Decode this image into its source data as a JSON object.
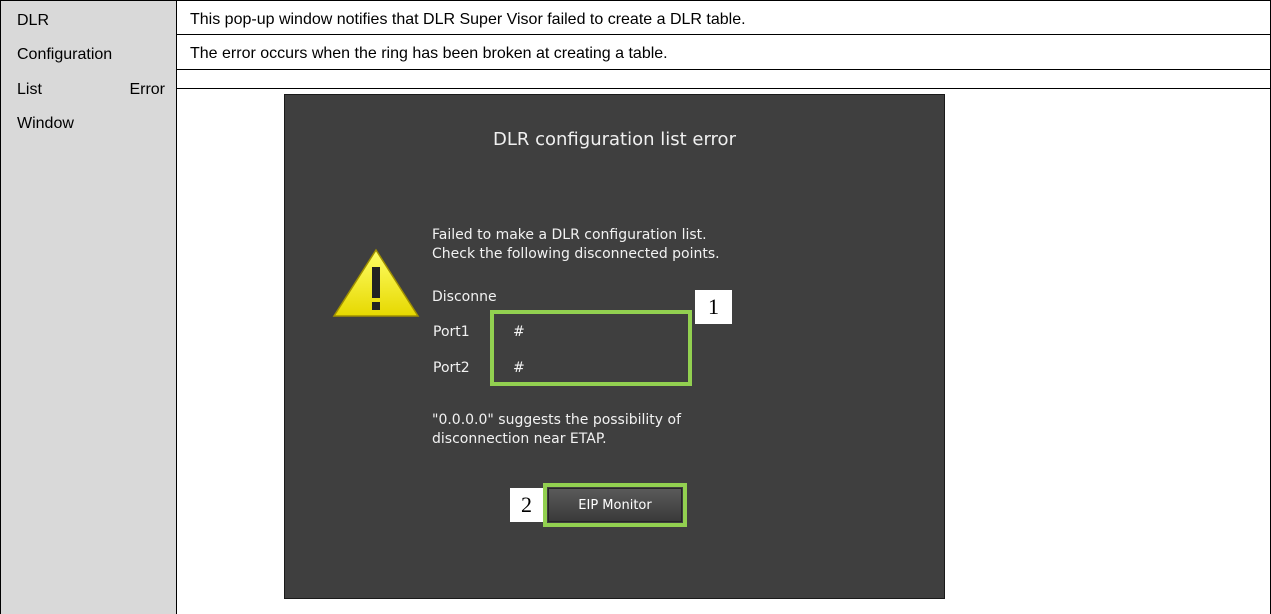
{
  "left_label": {
    "line1": "DLR",
    "line2": "Configuration",
    "line3a": "List",
    "line3b": "Error",
    "line4": "Window"
  },
  "description": {
    "line1": "This pop-up window notifies that DLR Super Visor failed to create a DLR table.",
    "line2": "The error occurs when the ring has been broken at creating a table."
  },
  "dialog": {
    "title": "DLR configuration list error",
    "message_line1": "Failed to make a DLR configuration list.",
    "message_line2": "Check the following disconnected points.",
    "disconnected_label": "Disconne",
    "port1_label": "Port1",
    "port1_value": "#",
    "port2_label": "Port2",
    "port2_value": "#",
    "note_line1": "\"0.0.0.0\" suggests the possibility of",
    "note_line2": "disconnection near ETAP.",
    "eip_button_label": "EIP Monitor",
    "warning_icon": "warning-triangle-icon"
  },
  "callouts": {
    "one": "1",
    "two": "2"
  },
  "colors": {
    "left_column_bg": "#d9d9d9",
    "dialog_bg": "#3f3f3f",
    "highlight": "#92d050",
    "warning_yellow": "#ffff00"
  }
}
